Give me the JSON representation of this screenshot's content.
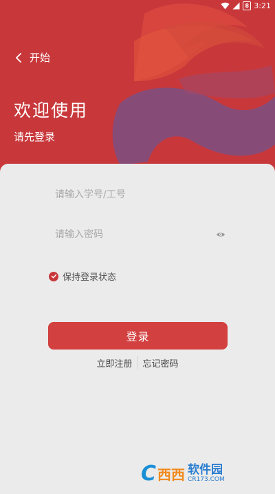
{
  "status_bar": {
    "battery": "8",
    "time": "3:21",
    "icons": [
      "wifi-icon",
      "signal-icon",
      "battery-icon"
    ]
  },
  "header": {
    "back_label": "开始",
    "title": "欢迎使用",
    "subtitle": "请先登录"
  },
  "form": {
    "username_placeholder": "请输入学号/工号",
    "username_value": "",
    "password_placeholder": "请输入密码",
    "password_value": "",
    "remember_label": "保持登录状态",
    "remember_checked": true,
    "login_label": "登录"
  },
  "links": {
    "register": "立即注册",
    "forgot": "忘记密码"
  },
  "watermark": {
    "name": "软件园",
    "url": "CR173.COM"
  },
  "colors": {
    "header": "#c8383b",
    "accent": "#d2403f",
    "background": "#ebebeb"
  }
}
